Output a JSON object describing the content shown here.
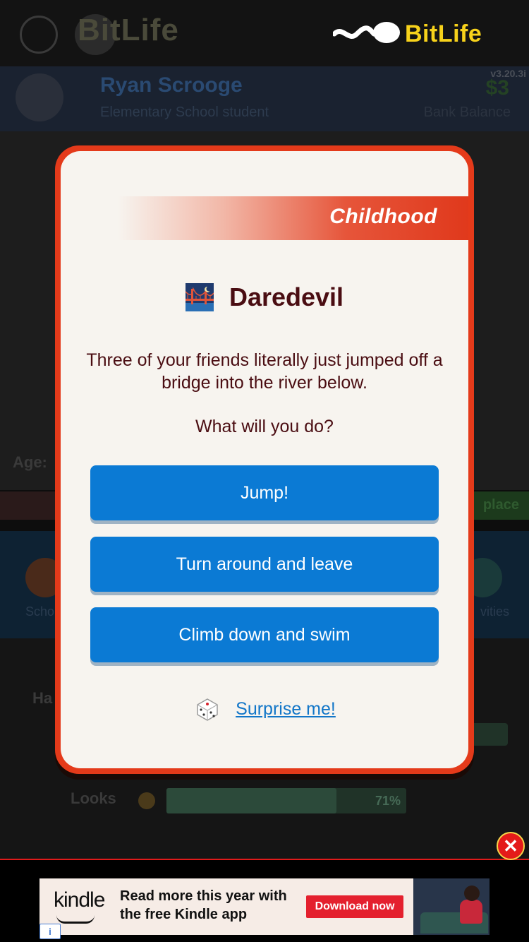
{
  "brand": {
    "name": "BitLife"
  },
  "background": {
    "app_logo_faint": "BitLife",
    "profile": {
      "name": "Ryan Scrooge",
      "subtitle": "Elementary School student",
      "version": "v3.20.3i",
      "money": "$3",
      "money_label": "Bank Balance"
    },
    "age_label": "Age:",
    "strip_label": "place",
    "nav": {
      "left_label": "Scho",
      "right_label": "vities"
    },
    "stats": {
      "heading": "Ha",
      "looks_label": "Looks",
      "looks_value": "71%",
      "looks_fraction": 0.71
    }
  },
  "modal": {
    "category": "Childhood",
    "title": "Daredevil",
    "title_icon": "bridge-night-icon",
    "description": "Three of your friends literally just jumped off a bridge into the river below.",
    "question": "What will you do?",
    "choices": [
      "Jump!",
      "Turn around and leave",
      "Climb down and swim"
    ],
    "surprise_label": "Surprise me!",
    "surprise_icon": "dice-icon"
  },
  "ad": {
    "logo": "kindle",
    "copy_line1": "Read more this year with",
    "copy_line2": "the free Kindle app",
    "cta": "Download now",
    "info_icon": "info-icon",
    "close_icon": "close-icon"
  },
  "colors": {
    "modal_border": "#e43a1a",
    "modal_bg": "#f7f4ef",
    "button_blue": "#0b7ad4",
    "title_text": "#4a0d12",
    "link_blue": "#1276c8",
    "brand_yellow": "#f7d21b",
    "ad_cta_red": "#e4202e"
  }
}
